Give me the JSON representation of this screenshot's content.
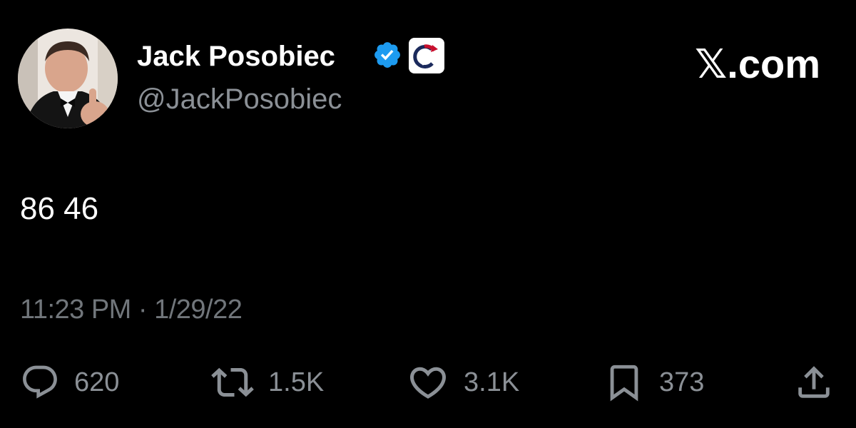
{
  "author": {
    "name": "Jack Posobiec",
    "handle": "@JackPosobiec",
    "verified_color": "#1d9bf0"
  },
  "site_logo": "𝕏.com",
  "tweet": {
    "text": "86 46",
    "timestamp": "11:23 PM · 1/29/22"
  },
  "actions": {
    "replies": "620",
    "reposts": "1.5K",
    "likes": "3.1K",
    "bookmarks": "373"
  },
  "icons": {
    "avatar": "profile-photo",
    "verified": "verified-badge-icon",
    "affiliate": "affiliate-badge-icon",
    "reply": "reply-icon",
    "repost": "repost-icon",
    "like": "heart-icon",
    "bookmark": "bookmark-icon",
    "share": "share-icon"
  }
}
